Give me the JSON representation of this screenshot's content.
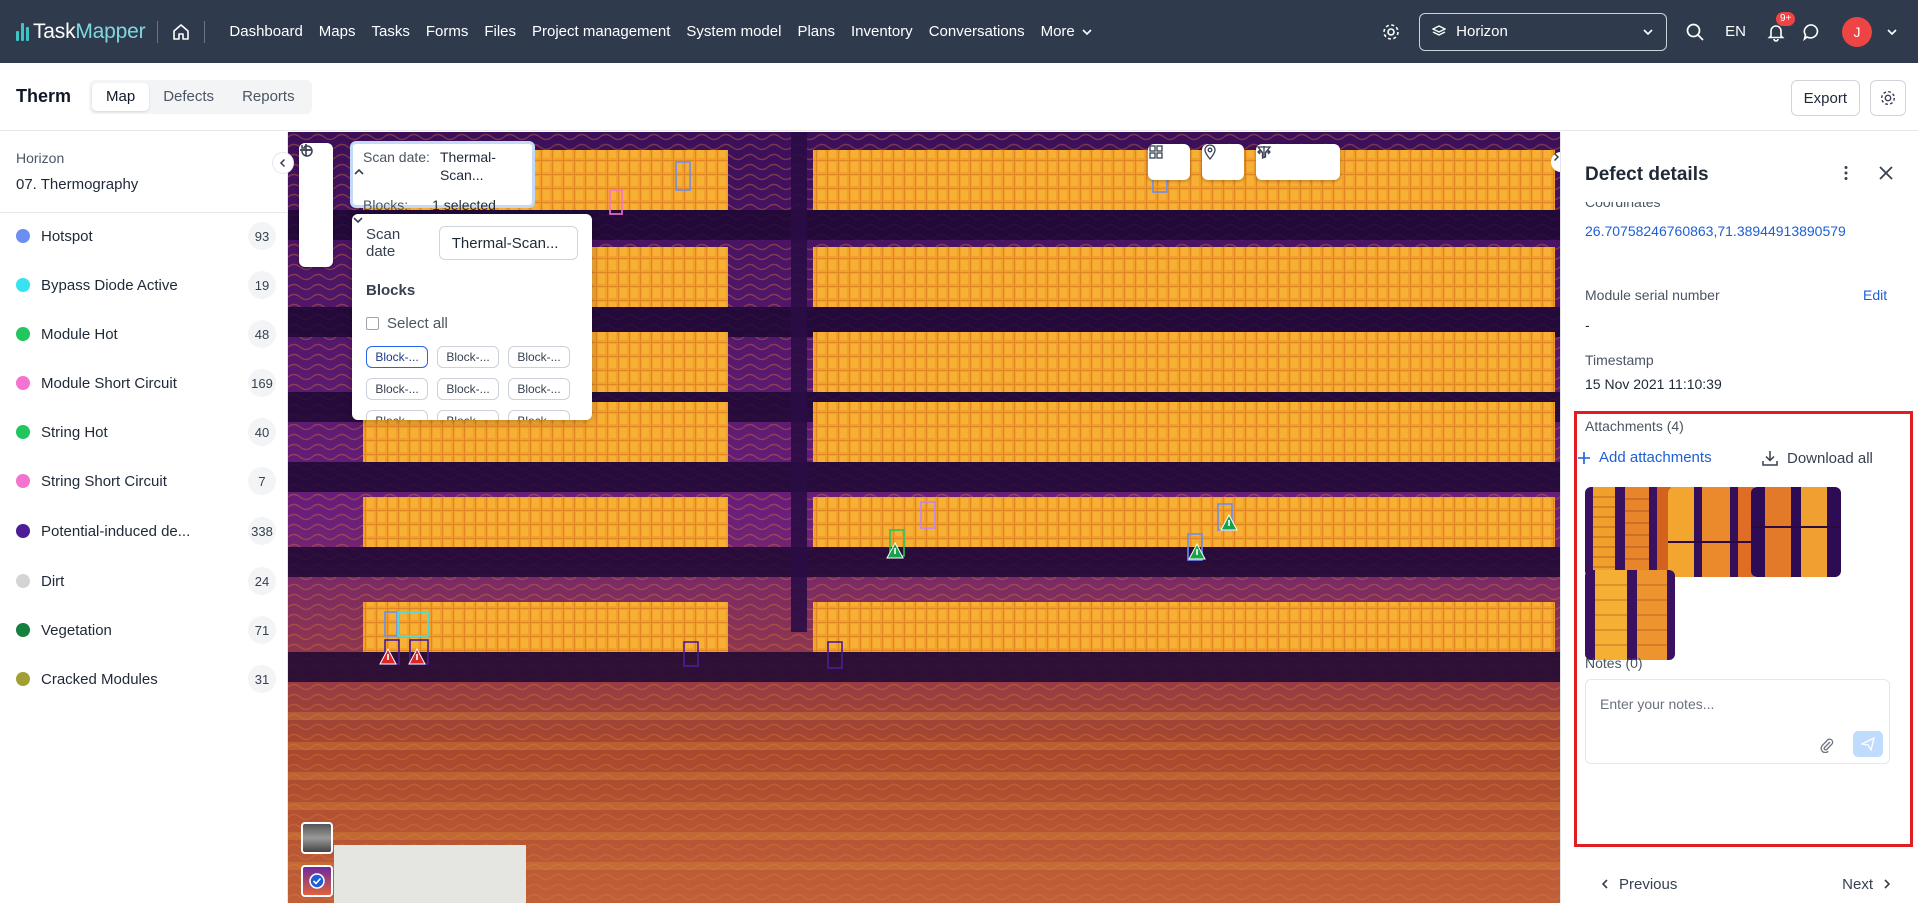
{
  "app": {
    "logo_task": "Task",
    "logo_mapper": "Mapper"
  },
  "nav": [
    "Dashboard",
    "Maps",
    "Tasks",
    "Forms",
    "Files",
    "Project management",
    "System model",
    "Plans",
    "Inventory",
    "Conversations"
  ],
  "nav_more": "More",
  "project_selector": "Horizon",
  "language": "EN",
  "notifications_badge": "9+",
  "user_initial": "J",
  "page": {
    "title": "Therm",
    "tabs": [
      "Map",
      "Defects",
      "Reports"
    ],
    "active_tab": "Map",
    "export_label": "Export"
  },
  "sidebar": {
    "project": "Horizon",
    "layer": "07. Thermography",
    "classes": [
      {
        "name": "Hotspot",
        "count": "93",
        "color": "#6b8ef0"
      },
      {
        "name": "Bypass Diode Active",
        "count": "19",
        "color": "#36e3f2"
      },
      {
        "name": "Module Hot",
        "count": "48",
        "color": "#22c55e"
      },
      {
        "name": "Module Short Circuit",
        "count": "169",
        "color": "#f472d0"
      },
      {
        "name": "String Hot",
        "count": "40",
        "color": "#22c55e"
      },
      {
        "name": "String Short Circuit",
        "count": "7",
        "color": "#f472d0"
      },
      {
        "name": "Potential-induced de...",
        "count": "338",
        "color": "#4c1d95"
      },
      {
        "name": "Dirt",
        "count": "24",
        "color": "#d4d4d4"
      },
      {
        "name": "Vegetation",
        "count": "71",
        "color": "#15803d"
      },
      {
        "name": "Cracked Modules",
        "count": "31",
        "color": "#a3a033"
      }
    ]
  },
  "scan": {
    "scan_date_label": "Scan date:",
    "scan_date_value": "Thermal-Scan...",
    "blocks_label": "Blocks:",
    "blocks_value": "1 selected",
    "dd_scan_date_label": "Scan date",
    "dd_scan_date_value": "Thermal-Scan...",
    "dd_blocks_title": "Blocks",
    "dd_select_all": "Select all",
    "dd_chips": [
      "Block-...",
      "Block-...",
      "Block-...",
      "Block-...",
      "Block-...",
      "Block-...",
      "Block-...",
      "Block-...",
      "Block-..."
    ]
  },
  "panel": {
    "title": "Defect details",
    "coordinates_label": "Coordinates",
    "coordinates_value": "26.70758246760863,71.38944913890579",
    "serial_label": "Module serial number",
    "serial_edit": "Edit",
    "serial_value": "-",
    "timestamp_label": "Timestamp",
    "timestamp_value": "15 Nov 2021 11:10:39",
    "attachments_title": "Attachments (4)",
    "add_attachments": "Add attachments",
    "download_all": "Download all",
    "notes_title": "Notes (0)",
    "notes_placeholder": "Enter your notes...",
    "previous": "Previous",
    "next": "Next"
  }
}
